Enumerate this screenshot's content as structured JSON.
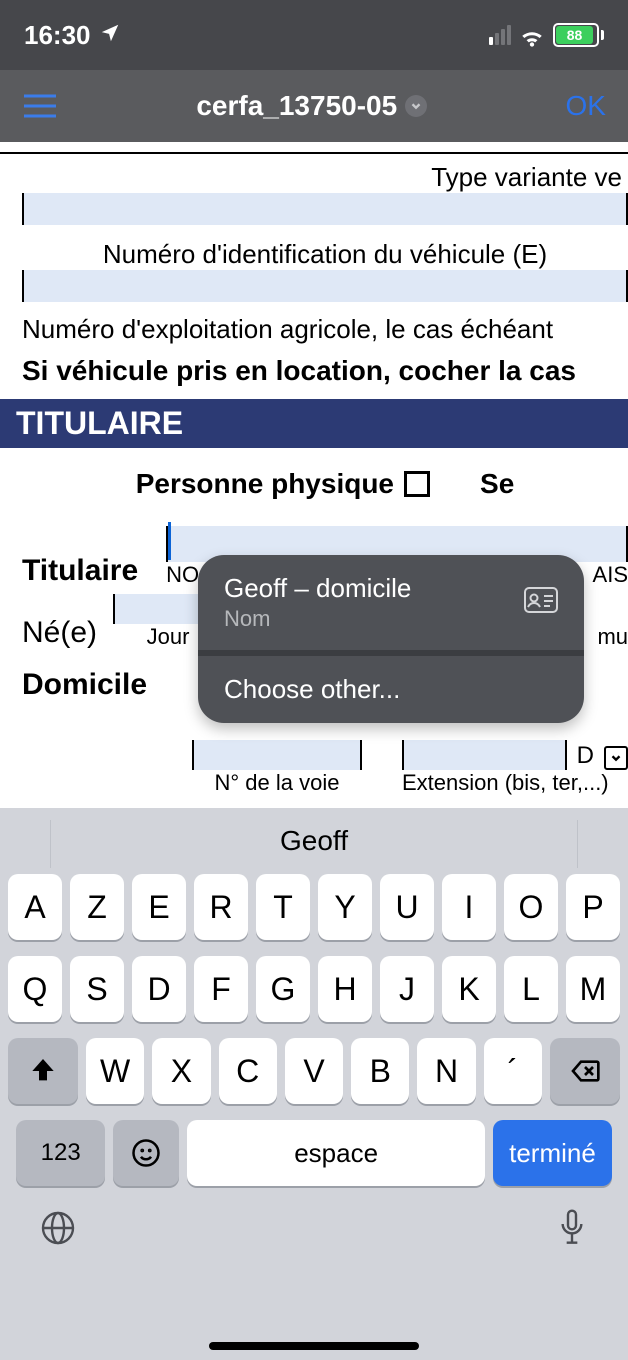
{
  "status": {
    "time": "16:30",
    "battery_pct": "88"
  },
  "nav": {
    "title": "cerfa_13750-05",
    "ok": "OK"
  },
  "doc": {
    "type_variante": "Type variante ve",
    "vin": "Numéro d'identification du véhicule (E)",
    "agri": "Numéro d'exploitation agricole, le cas échéant",
    "location_line": "Si véhicule pris en location, cocher la cas",
    "titulaire_header": "TITULAIRE",
    "personne_physique": "Personne physique",
    "sexe": "Se",
    "titulaire_label": "Titulaire",
    "nom_under": "NO",
    "nom_under2": "AIS",
    "ne_label": "Né(e)",
    "jour": "Jour",
    "mu": "mu",
    "domicile_label": "Domicile",
    "d": "D",
    "nvoie": "N° de la voie",
    "ext": "Extension (bis, ter,...)"
  },
  "popover": {
    "contact": "Geoff – domicile",
    "field": "Nom",
    "choose": "Choose other..."
  },
  "keyboard": {
    "prediction": "Geoff",
    "row1": [
      "A",
      "Z",
      "E",
      "R",
      "T",
      "Y",
      "U",
      "I",
      "O",
      "P"
    ],
    "row2": [
      "Q",
      "S",
      "D",
      "F",
      "G",
      "H",
      "J",
      "K",
      "L",
      "M"
    ],
    "row3": [
      "W",
      "X",
      "C",
      "V",
      "B",
      "N",
      "´"
    ],
    "num": "123",
    "space": "espace",
    "done": "terminé"
  }
}
